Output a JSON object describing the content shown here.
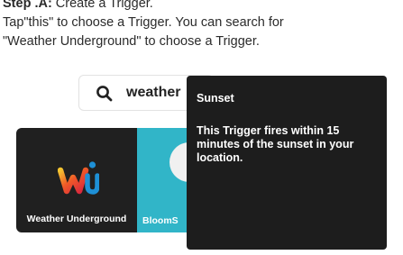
{
  "instructions": {
    "heading_strong": "Step .A:",
    "heading_rest": " Create a Trigger.",
    "body_line1": "Tap\"this\" to choose a Trigger. You can search for",
    "body_line2": "\"Weather Underground\" to choose a Trigger."
  },
  "search": {
    "value": "weather",
    "icon": "search-icon"
  },
  "services": [
    {
      "label": "Weather Underground",
      "color": "#202020",
      "icon": "weather-underground-logo-icon"
    },
    {
      "label": "BloomS",
      "color": "#31b5c8",
      "icon": "bloomsky-logo-icon"
    }
  ],
  "tooltip": {
    "title": "Sunset",
    "description": "This Trigger fires within 15 minutes of the sunset in your location."
  },
  "colors": {
    "tooltip_bg": "#1d1d1d",
    "bloom_bg": "#31b5c8",
    "wu_bg": "#202020"
  }
}
